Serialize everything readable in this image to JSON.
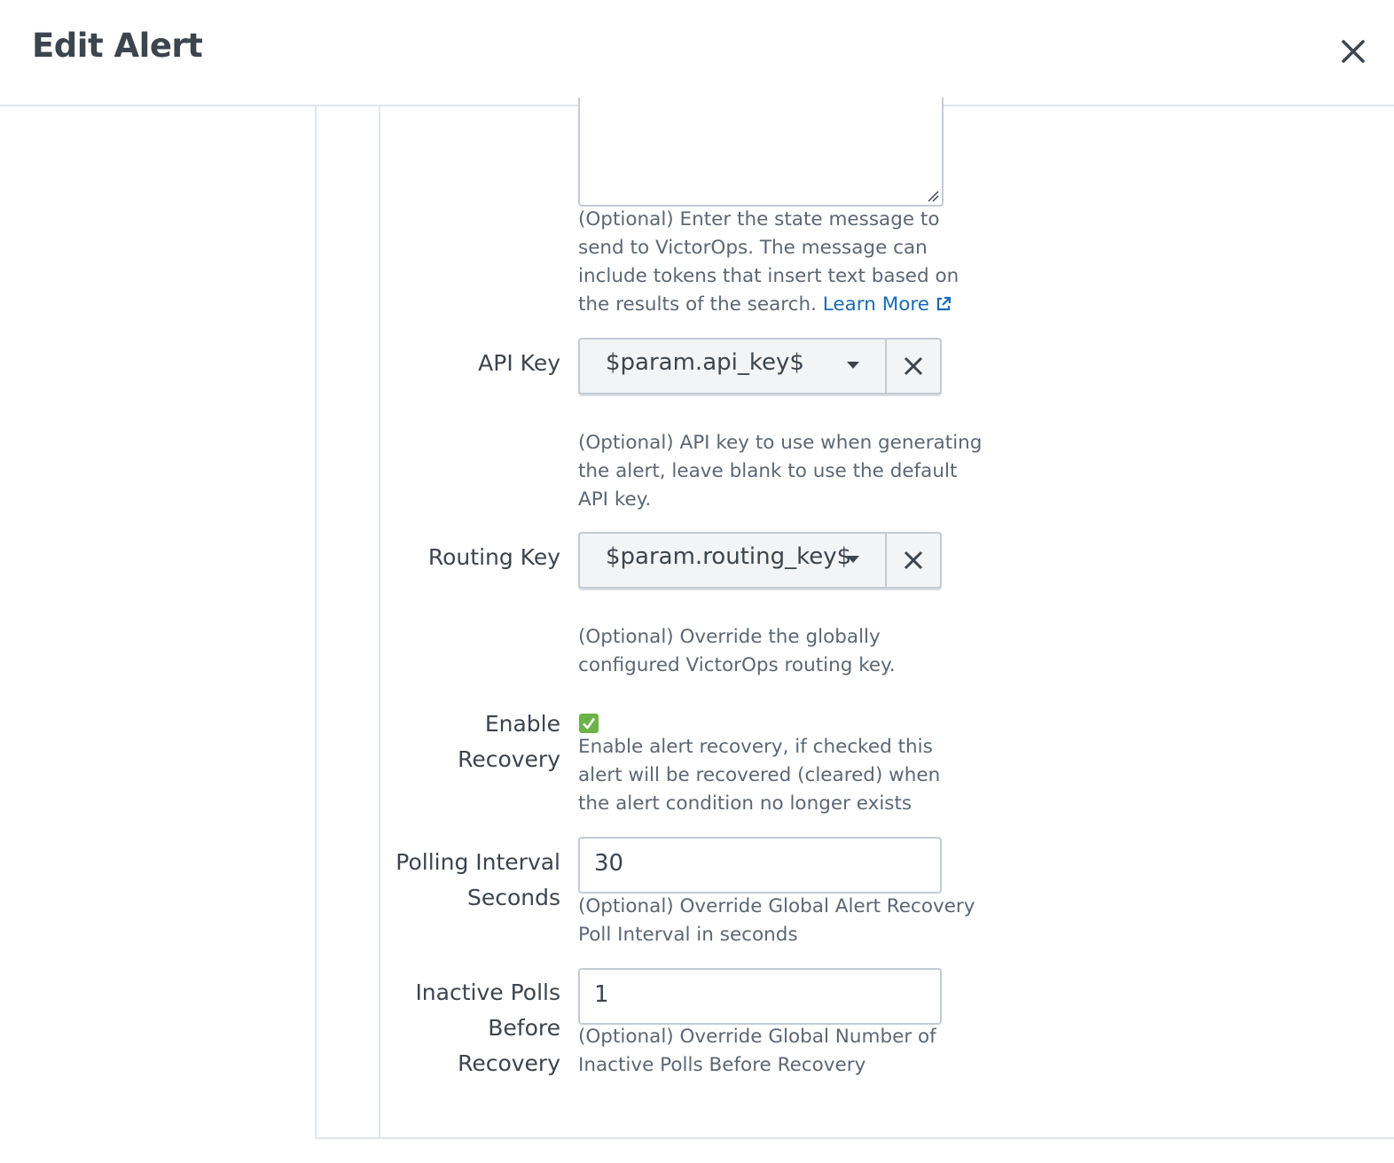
{
  "header": {
    "title": "Edit Alert"
  },
  "state_message": {
    "help_text": "(Optional) Enter the state message to send to VictorOps. The message can include tokens that insert text based on the results of the search.",
    "learn_more": "Learn More"
  },
  "api_key": {
    "label": "API Key",
    "value": "$param.api_key$",
    "help_text": "(Optional) API key to use when generating the alert, leave blank to use the default API key."
  },
  "routing_key": {
    "label": "Routing Key",
    "value": "$param.routing_key$",
    "help_text": "(Optional) Override the globally configured VictorOps routing key."
  },
  "enable_recovery": {
    "label_line1": "Enable",
    "label_line2": "Recovery",
    "checked": true,
    "help_text": "Enable alert recovery, if checked this alert will be recovered (cleared) when the alert condition no longer exists"
  },
  "polling_interval": {
    "label_line1": "Polling Interval",
    "label_line2": "Seconds",
    "value": "30",
    "help_text": "(Optional) Override Global Alert Recovery Poll Interval in seconds"
  },
  "inactive_polls": {
    "label_line1": "Inactive Polls",
    "label_line2": "Before",
    "label_line3": "Recovery",
    "value": "1",
    "help_text": "(Optional) Override Global Number of Inactive Polls Before Recovery"
  },
  "colors": {
    "link": "#1a6bb5",
    "checkbox": "#6cb348",
    "border": "#c3cbd4"
  }
}
